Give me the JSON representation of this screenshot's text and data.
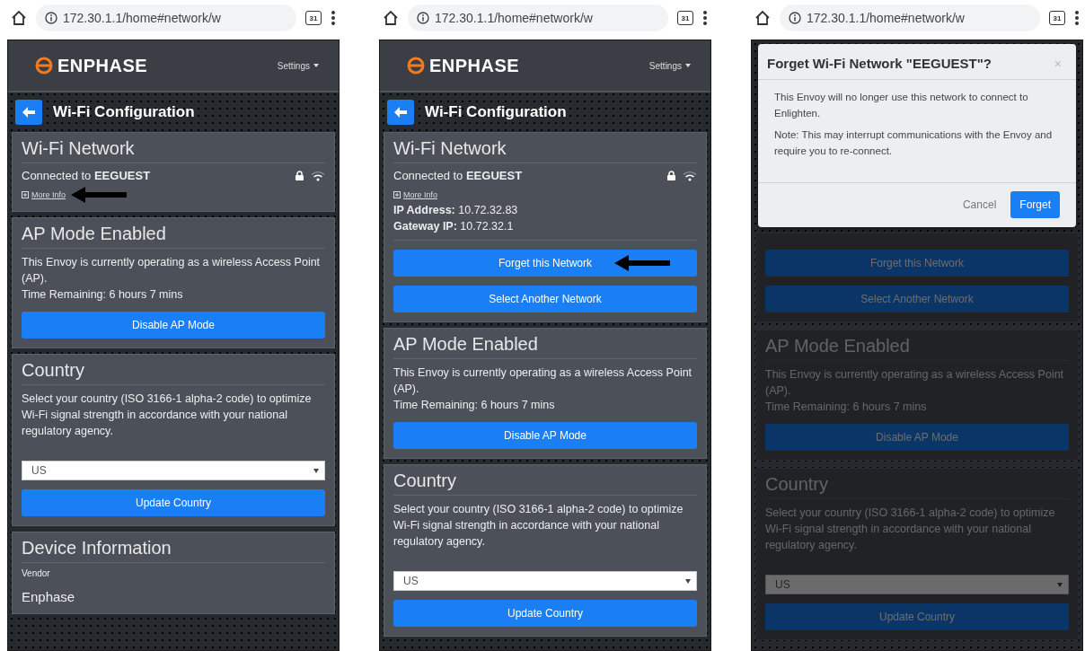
{
  "phones": [
    {
      "browser": {
        "url": "172.30.1.1/home#network/w",
        "tab_count": "31"
      },
      "header": {
        "logo": "ENPHASE",
        "menu": "Settings"
      },
      "page_title": "Wi-Fi Configuration",
      "cards": [
        {
          "title": "Wi-Fi Network",
          "items": [
            {
              "kind": "connection",
              "text": "Connected to **EEGUEST**"
            },
            {
              "kind": "link",
              "text": "More Info",
              "arrow": true
            }
          ]
        },
        {
          "title": "AP Mode Enabled",
          "items": [
            {
              "kind": "paragraph",
              "text": "This Envoy is currently operating as a wireless Access Point (AP)."
            },
            {
              "kind": "line",
              "text": "Time Remaining: 6 hours 7 mins"
            },
            {
              "kind": "button",
              "label": "Disable AP Mode",
              "arrow": false
            }
          ]
        },
        {
          "title": "Country",
          "items": [
            {
              "kind": "paragraph",
              "text": "Select your country (ISO 3166-1 alpha-2 code) to optimize Wi-Fi signal strength in accordance with your national regulatory agency."
            },
            {
              "kind": "select",
              "value": "US"
            },
            {
              "kind": "button",
              "label": "Update Country",
              "arrow": false
            }
          ]
        },
        {
          "title": "Device Information",
          "items": [
            {
              "kind": "label",
              "text": "Vendor"
            },
            {
              "kind": "value",
              "text": "Enphase"
            }
          ]
        }
      ]
    },
    {
      "browser": {
        "url": "172.30.1.1/home#network/w",
        "tab_count": "31"
      },
      "header": {
        "logo": "ENPHASE",
        "menu": "Settings"
      },
      "page_title": "Wi-Fi Configuration",
      "cards": [
        {
          "title": "Wi-Fi Network",
          "items": [
            {
              "kind": "connection",
              "text": "Connected to **EEGUEST**"
            },
            {
              "kind": "link",
              "text": "More Info",
              "arrow": false
            },
            {
              "kind": "line",
              "text": "**IP Address:** 10.72.32.83"
            },
            {
              "kind": "line",
              "text": "**Gateway IP:** 10.72.32.1"
            },
            {
              "kind": "divider"
            },
            {
              "kind": "button",
              "label": "Forget this Network",
              "arrow": true
            },
            {
              "kind": "button",
              "label": "Select Another Network",
              "arrow": false
            }
          ]
        },
        {
          "title": "AP Mode Enabled",
          "items": [
            {
              "kind": "paragraph",
              "text": "This Envoy is currently operating as a wireless Access Point (AP)."
            },
            {
              "kind": "line",
              "text": "Time Remaining: 6 hours 7 mins"
            },
            {
              "kind": "button",
              "label": "Disable AP Mode",
              "arrow": false
            }
          ]
        },
        {
          "title": "Country",
          "items": [
            {
              "kind": "paragraph",
              "text": "Select your country (ISO 3166-1 alpha-2 code) to optimize Wi-Fi signal strength in accordance with your national regulatory agency."
            },
            {
              "kind": "select",
              "value": "US"
            },
            {
              "kind": "button",
              "label": "Update Country",
              "arrow": false
            }
          ]
        }
      ]
    },
    {
      "browser": {
        "url": "172.30.1.1/home#network/w",
        "tab_count": "31"
      },
      "dialog": {
        "title": "Forget Wi-Fi Network \"EEGUEST\"?",
        "close": "×",
        "paragraphs": [
          "This Envoy will no longer use this network to connect to Enlighten.",
          "Note: This may interrupt communications with the Envoy and require you to re-connect."
        ],
        "cancel": "Cancel",
        "confirm": "Forget"
      },
      "cards": [
        {
          "items": [
            {
              "kind": "button",
              "label": "Forget this Network",
              "arrow": false
            },
            {
              "kind": "button",
              "label": "Select Another Network",
              "arrow": false
            }
          ]
        },
        {
          "title": "AP Mode Enabled",
          "items": [
            {
              "kind": "paragraph",
              "text": "This Envoy is currently operating as a wireless Access Point (AP)."
            },
            {
              "kind": "line",
              "text": "Time Remaining: 6 hours 7 mins"
            },
            {
              "kind": "button",
              "label": "Disable AP Mode",
              "arrow": false
            }
          ]
        },
        {
          "title": "Country",
          "items": [
            {
              "kind": "paragraph",
              "text": "Select your country (ISO 3166-1 alpha-2 code) to optimize Wi-Fi signal strength in accordance with your national regulatory agency."
            },
            {
              "kind": "select",
              "value": "US"
            },
            {
              "kind": "button",
              "label": "Update Country",
              "arrow": false
            }
          ]
        }
      ]
    }
  ]
}
